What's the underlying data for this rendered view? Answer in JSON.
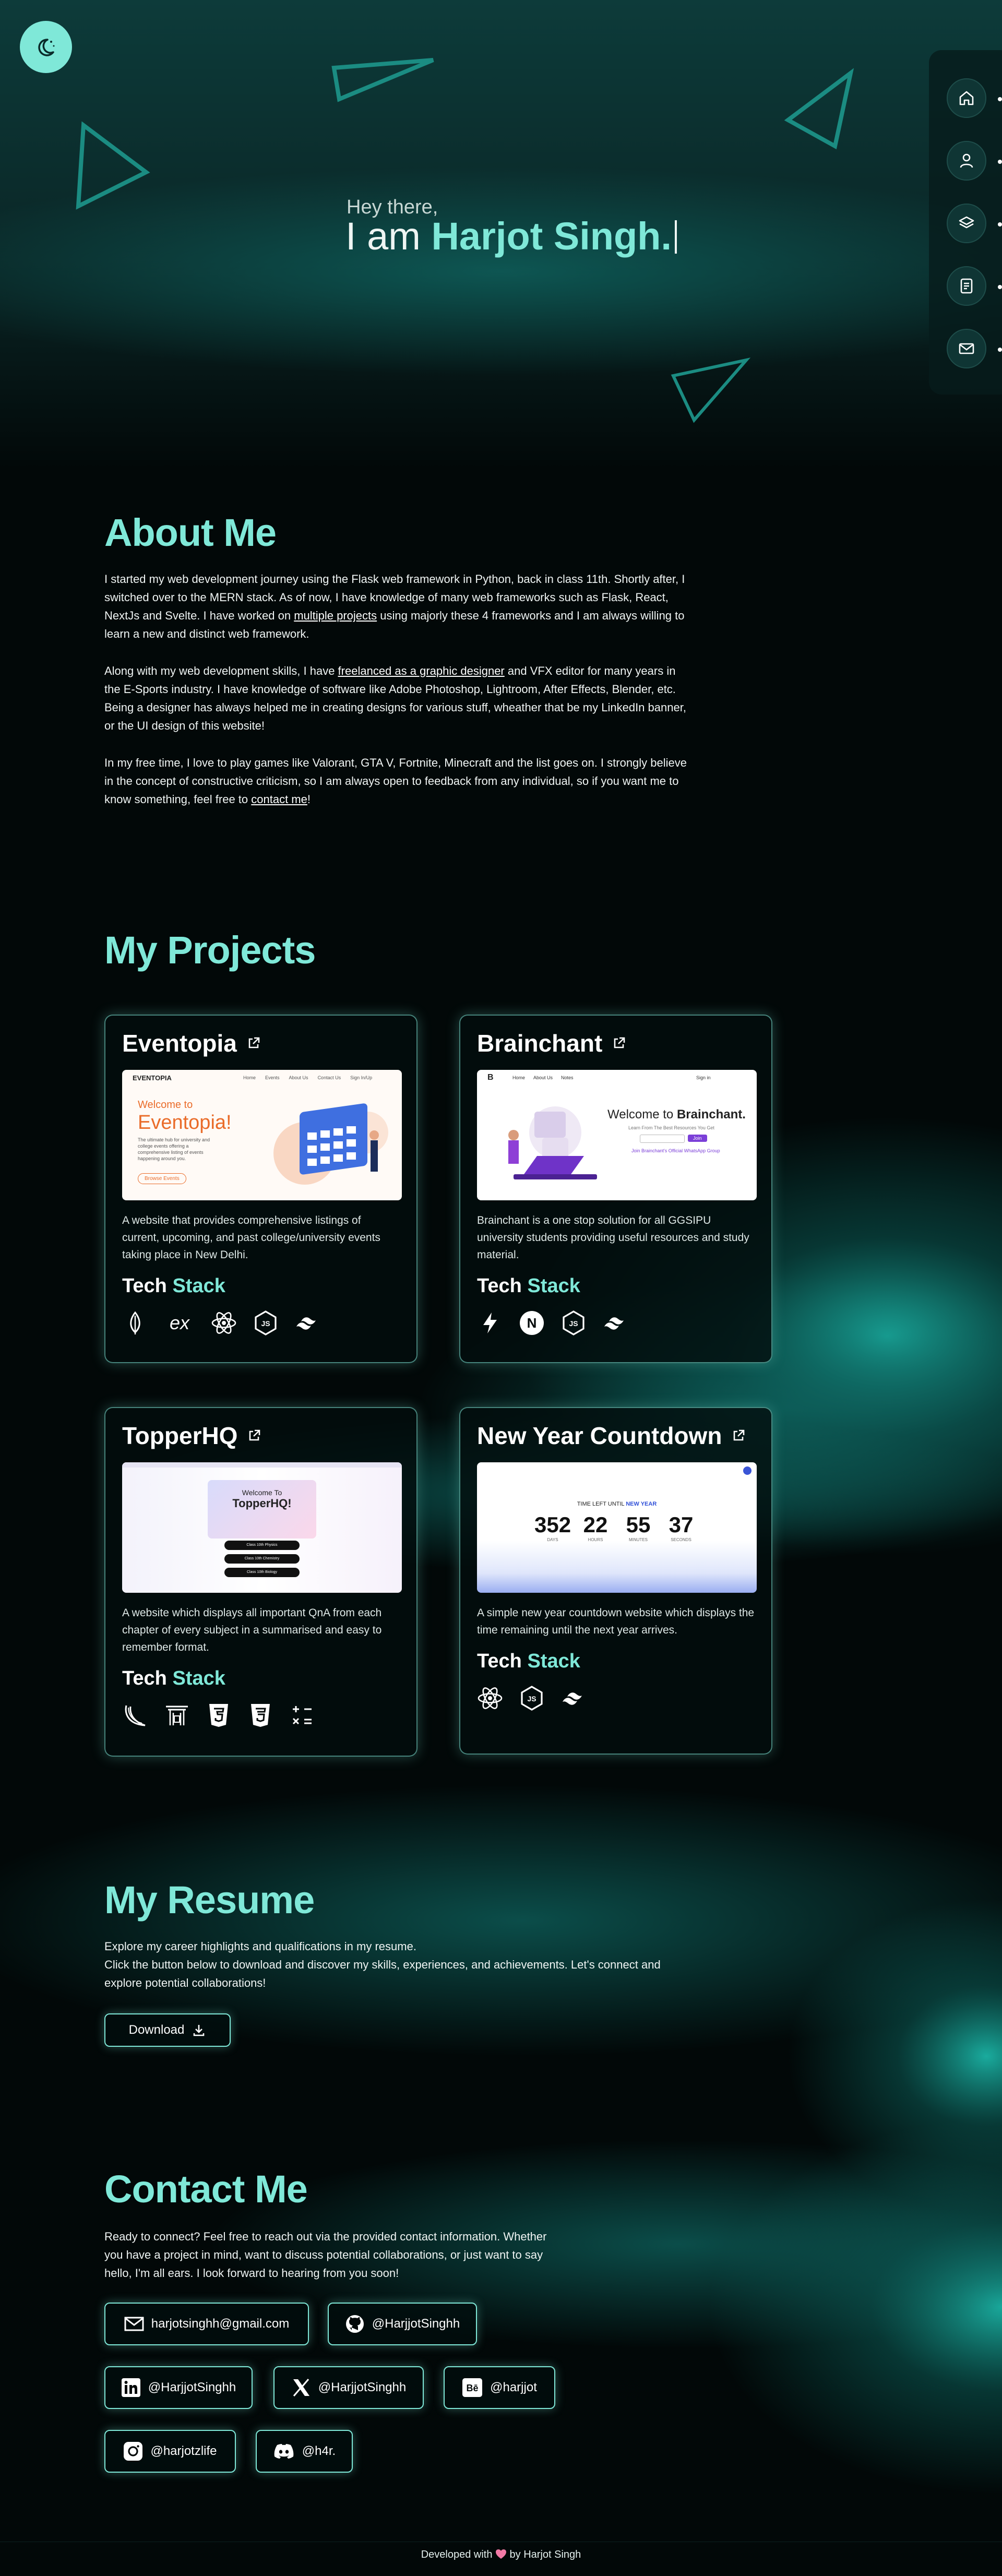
{
  "theme_toggle": {
    "icon": "moon-stars-icon"
  },
  "sidenav": {
    "items": [
      {
        "icon": "home-icon"
      },
      {
        "icon": "user-icon"
      },
      {
        "icon": "layers-icon"
      },
      {
        "icon": "document-icon"
      },
      {
        "icon": "mail-icon"
      }
    ]
  },
  "hero": {
    "greeting": "Hey there,",
    "prefix": "I am ",
    "name": "Harjot Singh."
  },
  "about": {
    "title": "About Me",
    "p1_a": "I started my web development journey using the Flask web framework in Python, back in class 11th. Shortly after, I switched over to the MERN stack. As of now, I have knowledge of many web frameworks such as Flask, React, NextJs and Svelte. I have worked on ",
    "p1_link": "multiple projects",
    "p1_b": " using majorly these 4 frameworks and I am always willing to learn a new and distinct web framework.",
    "p2_a": "Along with my web development skills, I have ",
    "p2_link": "freelanced as a graphic designer",
    "p2_b": " and VFX editor for many years in the E-Sports industry. I have knowledge of software like Adobe Photoshop, Lightroom, After Effects, Blender, etc. Being a designer has always helped me in creating designs for various stuff, wheather that be my LinkedIn banner, or the UI design of this website!",
    "p3_a": "In my free time, I love to play games like Valorant, GTA V, Fortnite, Minecraft and the list goes on. I strongly believe in the concept of constructive criticism, so I am always open to feedback from any individual, so if you want me to know something, feel free to ",
    "p3_link": "contact me",
    "p3_b": "!"
  },
  "projects": {
    "title": "My Projects",
    "stack_label_a": "Tech",
    "stack_label_b": "Stack",
    "items": [
      {
        "title": "Eventopia",
        "desc": "A website that provides comprehensive listings of current, upcoming, and past college/university events taking place in New Delhi.",
        "shot": {
          "brand": "EVENTOPIA",
          "nav": [
            "Home",
            "Events",
            "About Us",
            "Contact Us",
            "Sign In/Up"
          ],
          "welcome": "Welcome to",
          "heading": "Eventopia!",
          "blurb": "The ultimate hub for university and college events offering a comprehensive listing of events happening around you.",
          "button": "Browse Events"
        },
        "stack": [
          "mongodb-icon",
          "express-icon",
          "react-icon",
          "nodejs-icon",
          "tailwind-icon"
        ]
      },
      {
        "title": "Brainchant",
        "desc": "Brainchant is a one stop solution for all GGSIPU university students providing useful resources and study material.",
        "shot": {
          "brand": "B",
          "nav": [
            "Home",
            "About Us",
            "Notes"
          ],
          "login": "Sign in",
          "welcome": "Welcome to ",
          "heading": "Brainchant.",
          "sub": "Learn From The Best Resources You Get",
          "cta": "Join",
          "link": "Join Brainchant's Official WhatsApp Group"
        },
        "stack": [
          "vite-icon",
          "nextjs-icon",
          "nodejs-icon",
          "tailwind-icon"
        ]
      },
      {
        "title": "TopperHQ",
        "desc": "A website which displays all important QnA from each chapter of every subject in a summarised and easy to remember format.",
        "shot": {
          "welcome": "Welcome To",
          "heading": "TopperHQ!",
          "buttons": [
            "Class 10th Physics",
            "Class 10th Chemistry",
            "Class 10th Biology"
          ]
        },
        "stack": [
          "flask-icon",
          "jinja-icon",
          "html5-icon",
          "css3-icon",
          "math-icon"
        ]
      },
      {
        "title": "New Year Countdown",
        "desc": "A simple new year countdown website which displays the time remaining until the next year arrives.",
        "shot": {
          "label_a": "TIME LEFT UNTIL ",
          "label_b": "NEW YEAR",
          "values": [
            "352",
            "22",
            "55",
            "37"
          ],
          "units": [
            "DAYS",
            "HOURS",
            "MINUTES",
            "SECONDS"
          ]
        },
        "stack": [
          "react-icon",
          "nodejs-icon",
          "tailwind-icon"
        ]
      }
    ]
  },
  "resume": {
    "title": "My Resume",
    "line1": "Explore my career highlights and qualifications in my resume.",
    "line2": "Click the button below to download and discover my skills, experiences, and achievements. Let's connect and explore potential collaborations!",
    "button": "Download"
  },
  "contact": {
    "title": "Contact Me",
    "text": "Ready to connect? Feel free to reach out via the provided contact information. Whether you have a project in mind, want to discuss potential collaborations, or just want to say hello, I'm all ears. I look forward to hearing from you soon!",
    "links": [
      {
        "icon": "mail-icon",
        "label": "harjotsinghh@gmail.com"
      },
      {
        "icon": "github-icon",
        "label": "@HarjjotSinghh"
      },
      {
        "icon": "linkedin-icon",
        "label": "@HarjjotSinghh"
      },
      {
        "icon": "x-icon",
        "label": "@HarjjotSinghh"
      },
      {
        "icon": "behance-icon",
        "label": "@harjjot"
      },
      {
        "icon": "instagram-icon",
        "label": "@harjotzlife"
      },
      {
        "icon": "discord-icon",
        "label": "@h4r."
      }
    ]
  },
  "footer": {
    "text_a": "Developed with ",
    "text_b": " by Harjot Singh",
    "icon": "heart-icon"
  },
  "colors": {
    "accent": "#7fe8d8",
    "background": "#020808"
  }
}
